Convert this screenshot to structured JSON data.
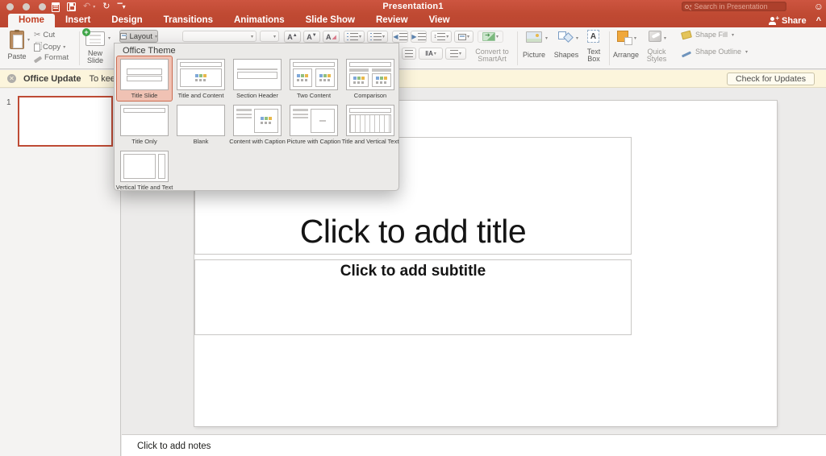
{
  "window": {
    "title": "Presentation1",
    "search_placeholder": "Search in Presentation",
    "share_label": "Share",
    "collapse_glyph": "^",
    "smiley_glyph": "☺"
  },
  "tabs": [
    {
      "label": "Home",
      "active": true
    },
    {
      "label": "Insert",
      "active": false
    },
    {
      "label": "Design",
      "active": false
    },
    {
      "label": "Transitions",
      "active": false
    },
    {
      "label": "Animations",
      "active": false
    },
    {
      "label": "Slide Show",
      "active": false
    },
    {
      "label": "Review",
      "active": false
    },
    {
      "label": "View",
      "active": false
    }
  ],
  "ribbon": {
    "paste": "Paste",
    "cut": "Cut",
    "copy": "Copy",
    "format": "Format",
    "new_slide": "New Slide",
    "layout": "Layout",
    "convert_smartart": "Convert to SmartArt",
    "picture": "Picture",
    "shapes": "Shapes",
    "text_box": "Text Box",
    "arrange": "Arrange",
    "quick_styles": "Quick Styles",
    "shape_fill": "Shape Fill",
    "shape_outline": "Shape Outline"
  },
  "layout_menu": {
    "header": "Office Theme",
    "items": [
      {
        "label": "Title Slide",
        "kind": "title_slide",
        "selected": true
      },
      {
        "label": "Title and Content",
        "kind": "title_content",
        "selected": false
      },
      {
        "label": "Section Header",
        "kind": "section_header",
        "selected": false
      },
      {
        "label": "Two Content",
        "kind": "two_content",
        "selected": false
      },
      {
        "label": "Comparison",
        "kind": "comparison",
        "selected": false
      },
      {
        "label": "Title Only",
        "kind": "title_only",
        "selected": false
      },
      {
        "label": "Blank",
        "kind": "blank",
        "selected": false
      },
      {
        "label": "Content with Caption",
        "kind": "content_caption",
        "selected": false
      },
      {
        "label": "Picture with Caption",
        "kind": "picture_caption",
        "selected": false
      },
      {
        "label": "Title and Vertical Text",
        "kind": "title_vertical",
        "selected": false
      },
      {
        "label": "Vertical Title and Text",
        "kind": "vertical_title",
        "selected": false
      }
    ]
  },
  "notification": {
    "title": "Office Update",
    "message": "To keep up-to-",
    "action": "Check for Updates"
  },
  "slides_panel": {
    "slide_number": "1"
  },
  "slide": {
    "title_placeholder": "Click to add title",
    "subtitle_placeholder": "Click to add subtitle"
  },
  "notes": {
    "placeholder": "Click to add notes"
  },
  "colors": {
    "titlebar_red": "#C04A33",
    "active_tab_text": "#C23E22",
    "selected_layout_bg": "#F0C2B4",
    "selected_layout_border": "#CC6C51",
    "notification_bg": "#FCF5DC",
    "slide_thumb_border": "#BE4B35"
  }
}
